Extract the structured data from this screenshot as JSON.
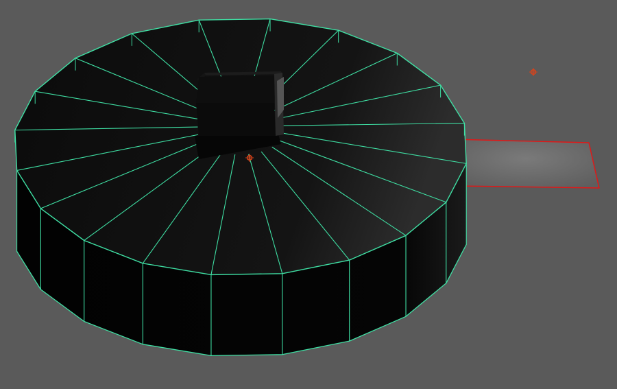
{
  "viewport": {
    "background_color": "#5a5a5a"
  },
  "scene": {
    "objects": [
      {
        "name": "cylinder",
        "segments": 20,
        "selected": true,
        "wireframe_color": "#3fe0a4",
        "fill_color": "#0a0a0a"
      },
      {
        "name": "box",
        "selected": false,
        "fill_color": "#0c0c0c"
      },
      {
        "name": "plane",
        "selected": true,
        "wireframe_color": "#e01818",
        "fill_color": "#686868"
      }
    ],
    "pivot_markers": [
      {
        "name": "object-pivot",
        "color": "#d9431a"
      },
      {
        "name": "world-pivot",
        "color": "#d9431a"
      }
    ]
  }
}
